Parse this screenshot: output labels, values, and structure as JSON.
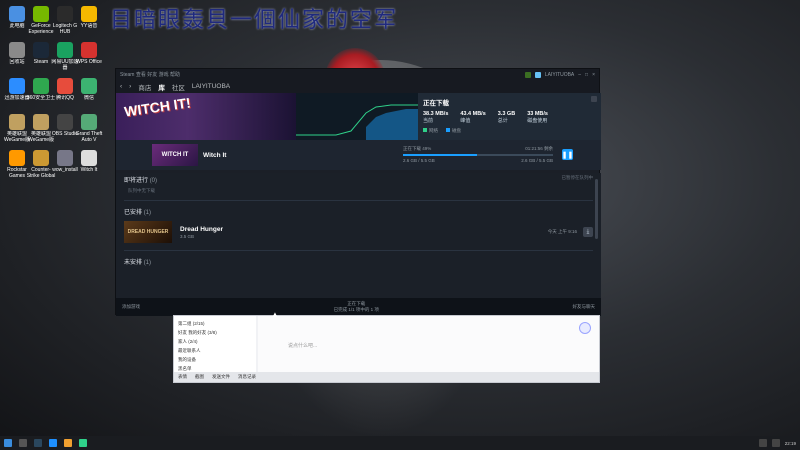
{
  "desktop": {
    "marquee": "目暗眼轰貝一個仙家的空军",
    "icons": [
      {
        "label": "此电脑"
      },
      {
        "label": "GeForce Experience"
      },
      {
        "label": "Logitech G HUB"
      },
      {
        "label": "YY语音"
      },
      {
        "label": "回收站"
      },
      {
        "label": "Steam"
      },
      {
        "label": "网易UU加速器"
      },
      {
        "label": "WPS Office"
      },
      {
        "label": "迅游加速器"
      },
      {
        "label": "360安全卫士"
      },
      {
        "label": "腾讯QQ"
      },
      {
        "label": "微信"
      },
      {
        "label": "英雄联盟WeGame版"
      },
      {
        "label": "英雄联盟WeGame版"
      },
      {
        "label": "OBS Studio"
      },
      {
        "label": "Grand Theft Auto V"
      },
      {
        "label": "Rockstar Games"
      },
      {
        "label": "Counter-Strike Global Offensive"
      },
      {
        "label": "wow_install"
      },
      {
        "label": "Witch It"
      }
    ]
  },
  "steam": {
    "titlebar": {
      "left": "Steam 查看 好友 游戏 帮助",
      "user": "LAIYITUOBA"
    },
    "nav": {
      "store": "商店",
      "library": "库",
      "community": "社区",
      "username": "LAIYITUOBA"
    },
    "hero": {
      "game_art_title": "WITCH IT!"
    },
    "stats": {
      "heading": "正在下载",
      "values": [
        {
          "value": "38.3 MB/s",
          "label": "当前"
        },
        {
          "value": "43.4 MB/s",
          "label": "峰值"
        },
        {
          "value": "3.3 GB",
          "label": "总计"
        },
        {
          "value": "33 MB/s",
          "label": "磁盘使用"
        }
      ],
      "legend": [
        "网络",
        "磁盘"
      ]
    },
    "current_download": {
      "name": "Witch It",
      "thumb_text": "WITCH IT",
      "status": "正在下载 49%",
      "remaining": "01:21:56 剩余",
      "downloaded": "2.6 GB / 5.5 GB",
      "disk": "2.6 GB / 5.5 GB",
      "progress_fraction": 0.49
    },
    "sections": {
      "upcoming": {
        "title": "即将进行",
        "count": "(0)",
        "empty_text": "队列中无下载",
        "right": "已暂停在队列中"
      },
      "scheduled": {
        "title": "已安排",
        "count": "(1)"
      },
      "unscheduled": {
        "title": "未安排",
        "count": "(1)"
      }
    },
    "queue": [
      {
        "name": "Dread Hunger",
        "thumb_text": "DREAD HUNGER",
        "size": "3.5 GB",
        "time": "今天 上午 9:16"
      }
    ],
    "footer": {
      "left": "添加游戏",
      "center_title": "正在下载",
      "center_sub": "已完成 1/1 项中的 1 项",
      "right": "好友与聊天"
    }
  },
  "chat": {
    "friends": [
      "第二组 (2/15)",
      "好友 我的好友 (3/8)",
      "家人 (2/4)",
      "最近联系人",
      "我的设备",
      "黑名单"
    ],
    "placeholder": "说点什么吧...",
    "toolbar": [
      "表情",
      "截图",
      "发送文件",
      "消息记录"
    ]
  },
  "taskbar": {
    "time": "22:19"
  }
}
